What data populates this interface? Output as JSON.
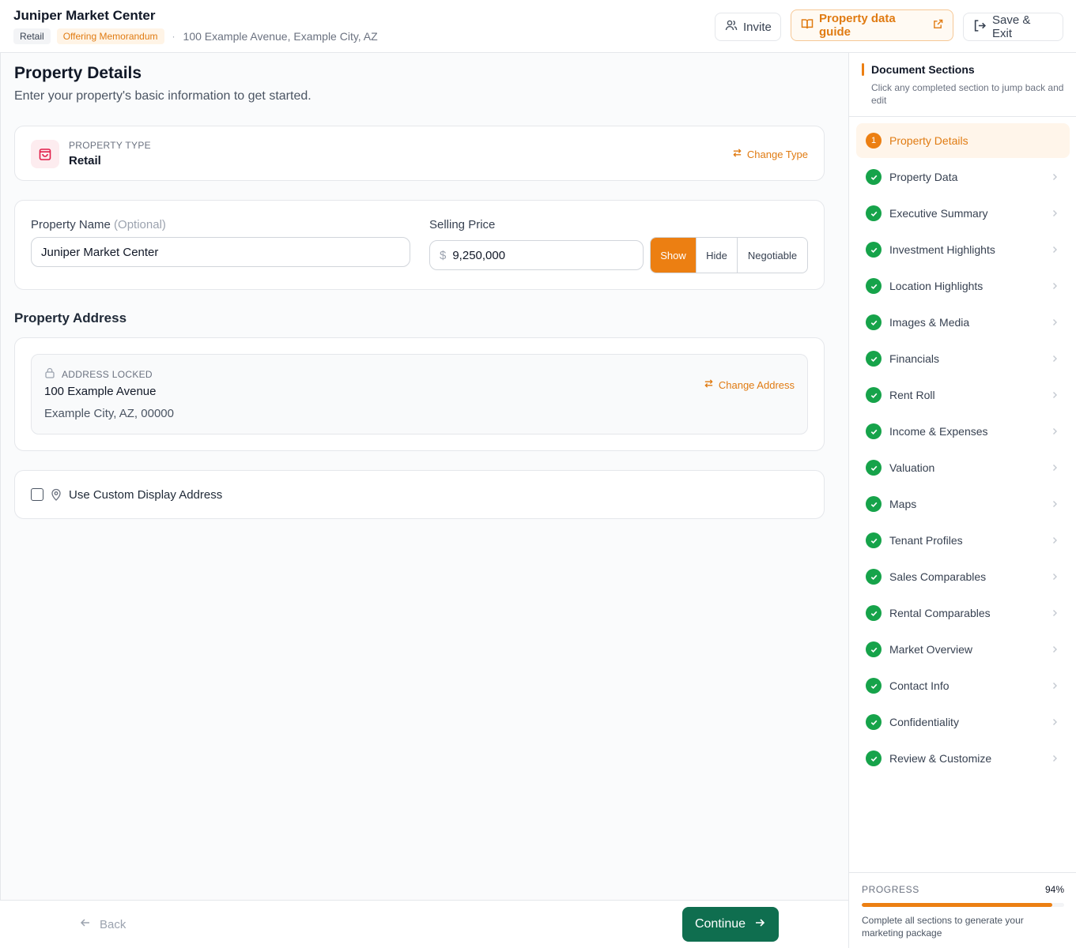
{
  "header": {
    "title": "Juniper Market Center",
    "tag_type": "Retail",
    "tag_doc": "Offering Memorandum",
    "separator": "·",
    "address": "100 Example Avenue, Example City, AZ",
    "invite_label": "Invite",
    "guide_label": "Property data guide",
    "exit_label": "Save & Exit"
  },
  "page": {
    "title": "Property Details",
    "subtitle": "Enter your property's basic information to get started."
  },
  "property_type": {
    "label": "PROPERTY TYPE",
    "value": "Retail",
    "change_label": "Change Type"
  },
  "fields": {
    "name_label": "Property Name",
    "name_optional": "(Optional)",
    "name_value": "Juniper Market Center",
    "price_label": "Selling Price",
    "price_currency": "$",
    "price_value": "9,250,000",
    "visibility_options": [
      "Show",
      "Hide",
      "Negotiable"
    ],
    "visibility_selected": "Show"
  },
  "address": {
    "heading": "Property Address",
    "locked_label": "ADDRESS LOCKED",
    "line1": "100 Example Avenue",
    "line2": "Example City, AZ, 00000",
    "change_label": "Change Address"
  },
  "custom_address": {
    "label": "Use Custom Display Address",
    "checked": false
  },
  "footer": {
    "back_label": "Back",
    "continue_label": "Continue"
  },
  "sidebar": {
    "title": "Document Sections",
    "subtitle": "Click any completed section to jump back and edit",
    "items": [
      {
        "label": "Property Details",
        "status": "current",
        "number": "1"
      },
      {
        "label": "Property Data",
        "status": "complete"
      },
      {
        "label": "Executive Summary",
        "status": "complete"
      },
      {
        "label": "Investment Highlights",
        "status": "complete"
      },
      {
        "label": "Location Highlights",
        "status": "complete"
      },
      {
        "label": "Images & Media",
        "status": "complete"
      },
      {
        "label": "Financials",
        "status": "complete"
      },
      {
        "label": "Rent Roll",
        "status": "complete"
      },
      {
        "label": "Income & Expenses",
        "status": "complete"
      },
      {
        "label": "Valuation",
        "status": "complete"
      },
      {
        "label": "Maps",
        "status": "complete"
      },
      {
        "label": "Tenant Profiles",
        "status": "complete"
      },
      {
        "label": "Sales Comparables",
        "status": "complete"
      },
      {
        "label": "Rental Comparables",
        "status": "complete"
      },
      {
        "label": "Market Overview",
        "status": "complete"
      },
      {
        "label": "Contact Info",
        "status": "complete"
      },
      {
        "label": "Confidentiality",
        "status": "complete"
      },
      {
        "label": "Review & Customize",
        "status": "complete"
      }
    ],
    "progress_label": "PROGRESS",
    "progress_percent": "94%",
    "progress_value": 0.94,
    "progress_note": "Complete all sections to generate your marketing package"
  },
  "colors": {
    "accent": "#ec7f12",
    "success": "#16a34a",
    "primary_button": "#0f6e4f"
  }
}
